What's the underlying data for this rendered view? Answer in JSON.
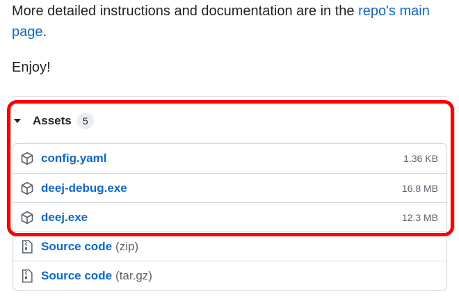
{
  "intro": {
    "text_before_link": "More detailed instructions and documentation are in the ",
    "link_text": "repo's main page",
    "text_after_link": ".",
    "enjoy": "Enjoy!"
  },
  "assets": {
    "title": "Assets",
    "count": "5",
    "files": [
      {
        "name": "config.yaml",
        "size": "1.36 KB",
        "icon": "package-icon"
      },
      {
        "name": "deej-debug.exe",
        "size": "16.8 MB",
        "icon": "package-icon"
      },
      {
        "name": "deej.exe",
        "size": "12.3 MB",
        "icon": "package-icon"
      }
    ],
    "source_code": [
      {
        "label": "Source code",
        "ext": "(zip)",
        "icon": "file-zip-icon"
      },
      {
        "label": "Source code",
        "ext": "(tar.gz)",
        "icon": "file-zip-icon"
      }
    ]
  },
  "colors": {
    "link": "#0969da",
    "highlight": "#ff0000",
    "muted": "#59636e",
    "border": "#d0d7de"
  }
}
